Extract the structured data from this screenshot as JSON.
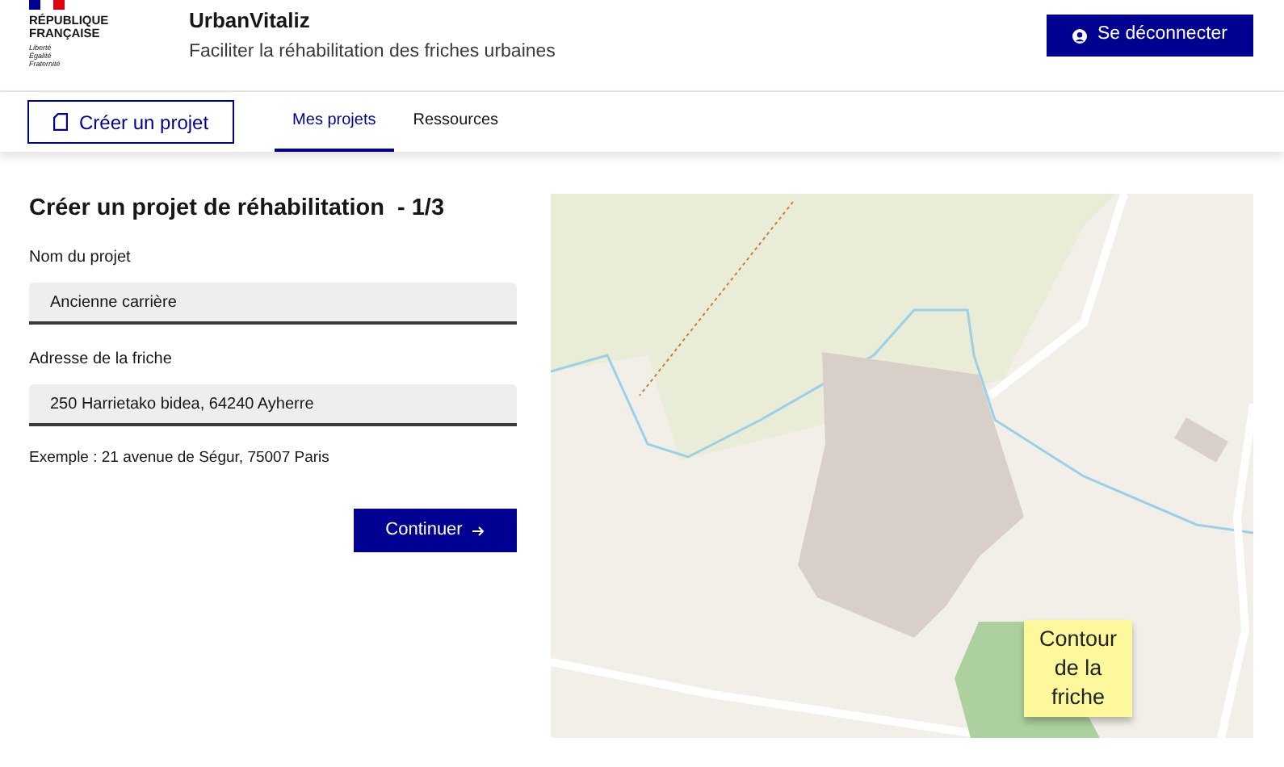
{
  "header": {
    "logo_lines": [
      "RÉPUBLIQUE",
      "FRANÇAISE"
    ],
    "motto": [
      "Liberté",
      "Égalité",
      "Fraternité"
    ],
    "site_title": "UrbanVitaliz",
    "tagline": "Faciliter la réhabilitation des friches urbaines",
    "logout_button": "Se déconnecter"
  },
  "nav": {
    "create_button": "Créer un projet",
    "tabs": [
      {
        "label": "Mes projets",
        "selected": true
      },
      {
        "label": "Ressources",
        "selected": false
      }
    ]
  },
  "form": {
    "title": "Créer un projet de réhabilitation  - 1/3",
    "fields": [
      {
        "label": "Nom du projet",
        "value": "Ancienne carrière"
      },
      {
        "label": "Adresse de la friche",
        "value": "250 Harrietako bidea, 64240 Ayherre"
      }
    ],
    "hint": "Exemple : 21 avenue de Ségur, 75007 Paris",
    "submit": "Continuer"
  },
  "map": {
    "note": "Contour de la friche"
  }
}
